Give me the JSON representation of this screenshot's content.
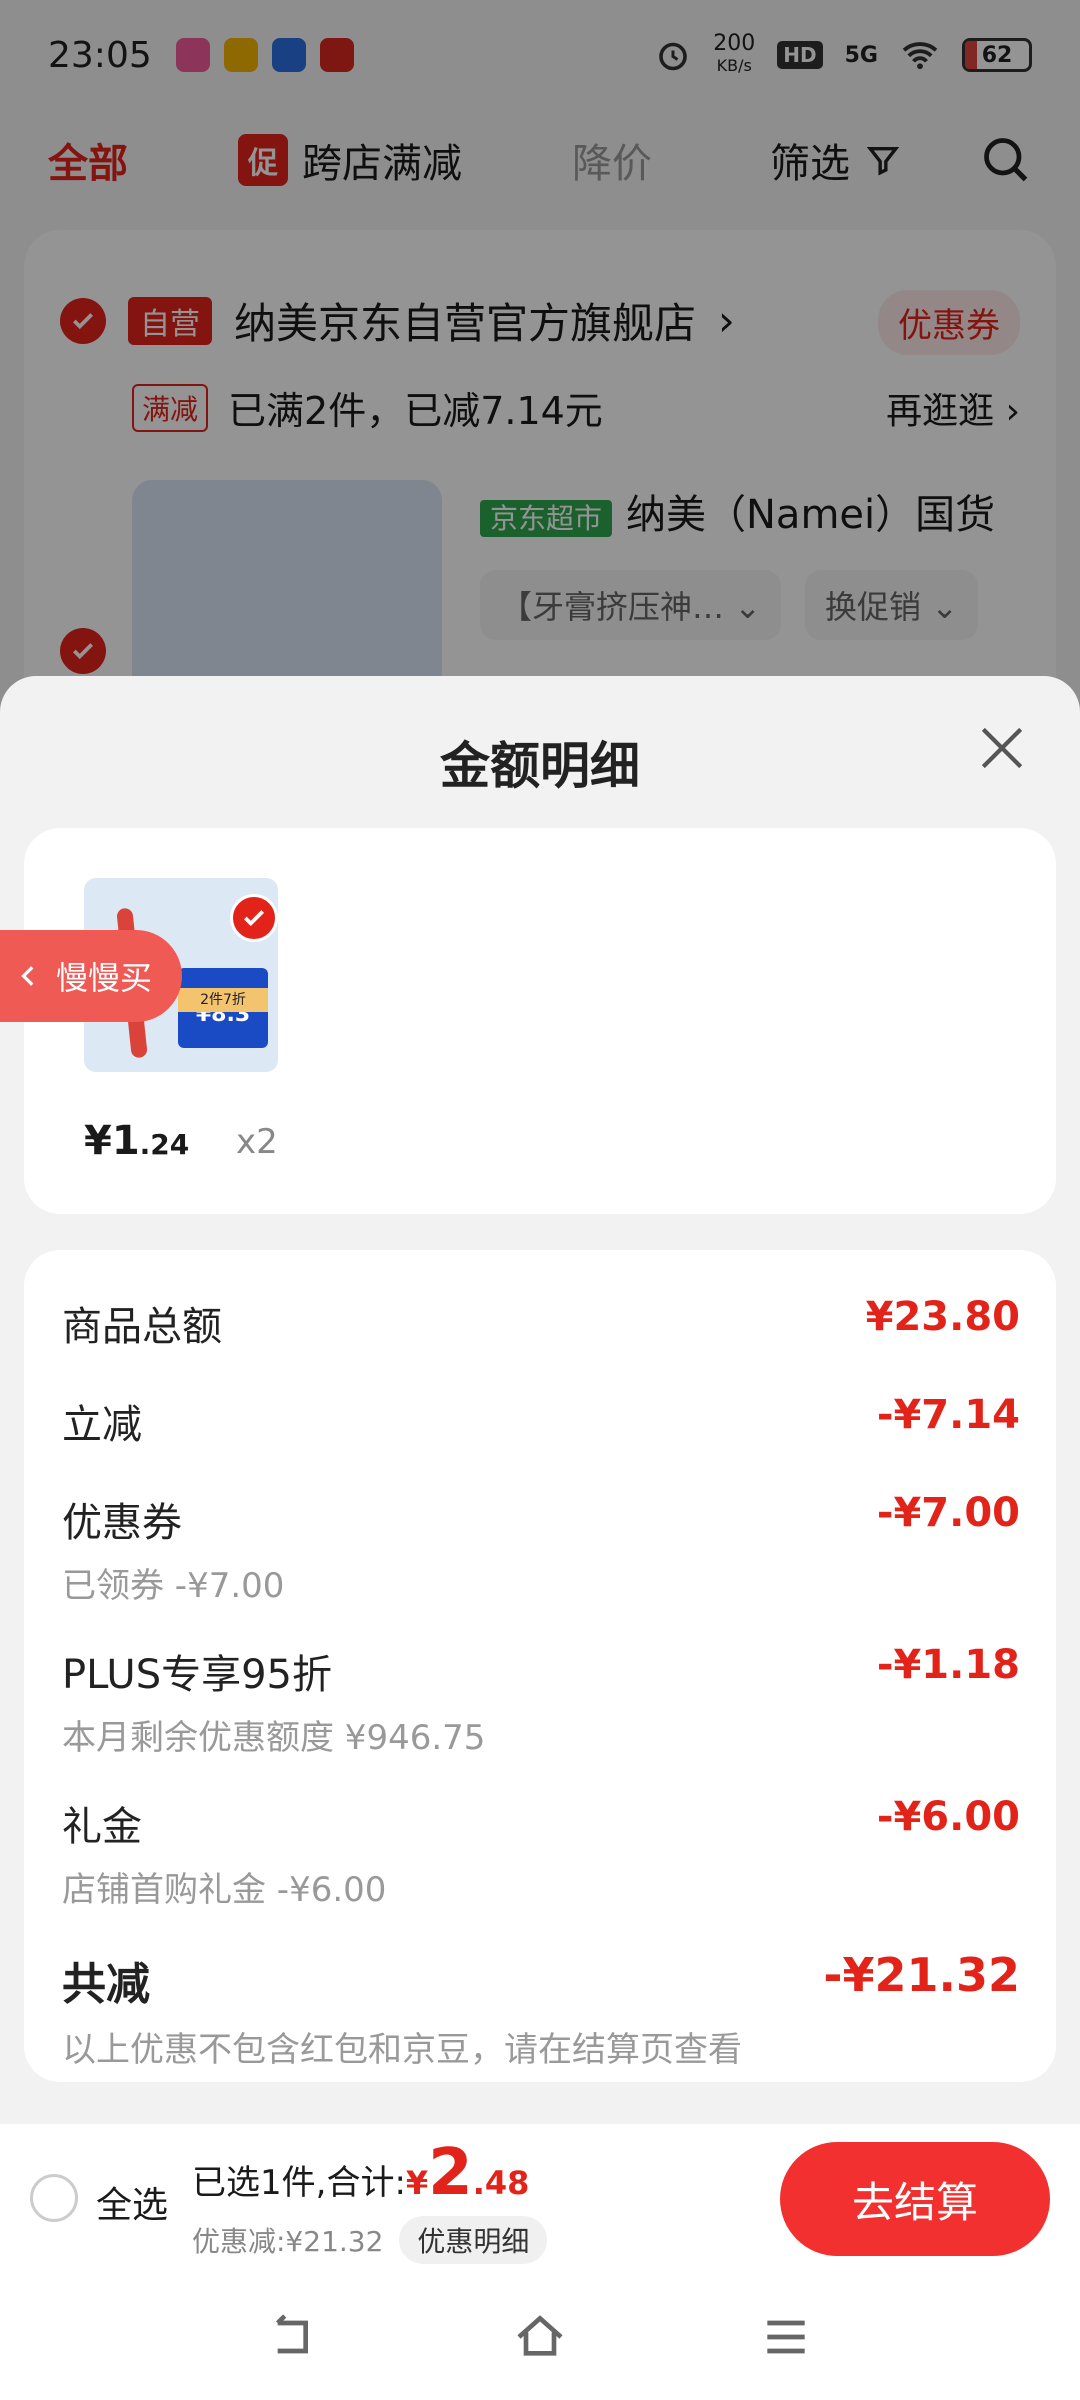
{
  "status_bar": {
    "time": "23:05",
    "speed": "200",
    "speed_unit": "KB/s",
    "hd": "HD",
    "network": "5G",
    "battery": "62"
  },
  "top_nav": {
    "all": "全部",
    "promo_tag": "促",
    "promo": "跨店满减",
    "price_drop": "降价",
    "filter": "筛选"
  },
  "store": {
    "self_tag": "自营",
    "name": "纳美京东自营官方旗舰店",
    "coupon": "优惠券",
    "promo_tag": "满减",
    "promo_text": "已满2件，已减7.14元",
    "more": "再逛逛",
    "super_tag": "京东超市",
    "product_name": "纳美（Namei）国货",
    "spec": "【牙膏挤压神…",
    "switch_promo": "换促销"
  },
  "sheet": {
    "title": "金额明细",
    "item": {
      "price_int": "¥1",
      "price_dec": ".24",
      "qty": "x2",
      "thumb_sale": "2件7折",
      "thumb_price": "¥8.3"
    },
    "slow_buy": "慢慢买",
    "rows": [
      {
        "label": "商品总额",
        "value": "¥23.80",
        "sub": ""
      },
      {
        "label": "立减",
        "value": "-¥7.14",
        "sub": ""
      },
      {
        "label": "优惠券",
        "value": "-¥7.00",
        "sub": "已领券 -¥7.00"
      },
      {
        "label": "PLUS专享95折",
        "value": "-¥1.18",
        "sub": "本月剩余优惠额度 ¥946.75"
      },
      {
        "label": "礼金",
        "value": "-¥6.00",
        "sub": "店铺首购礼金 -¥6.00"
      }
    ],
    "total": {
      "label": "共减",
      "value": "-¥21.32",
      "sub": "以上优惠不包含红包和京豆，请在结算页查看"
    }
  },
  "checkout": {
    "select_all": "全选",
    "selected": "已选1件,合计:",
    "currency": "¥",
    "amount_int": "2",
    "amount_dec": ".48",
    "discount": "优惠减:¥21.32",
    "detail": "优惠明细",
    "button": "去结算"
  }
}
